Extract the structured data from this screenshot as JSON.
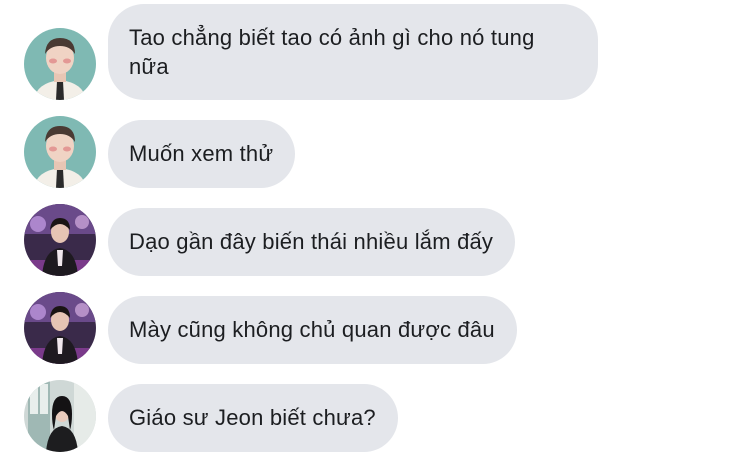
{
  "messages": [
    {
      "sender": "user-a",
      "text": "Tao chẳng biết tao có ảnh gì cho nó tung nữa"
    },
    {
      "sender": "user-a",
      "text": "Muốn xem thử"
    },
    {
      "sender": "user-b",
      "text": "Dạo gần đây biến thái nhiều lắm đấy"
    },
    {
      "sender": "user-b",
      "text": "Mày cũng không chủ quan được đâu"
    },
    {
      "sender": "user-c",
      "text": "Giáo sư Jeon biết chưa?"
    }
  ],
  "colors": {
    "bubble": "#e4e6eb",
    "text": "#1c1e21",
    "background": "#ffffff"
  },
  "icons": {
    "user-a": "avatar-man-teal-background",
    "user-b": "avatar-man-purple-studio",
    "user-c": "avatar-woman-window"
  }
}
